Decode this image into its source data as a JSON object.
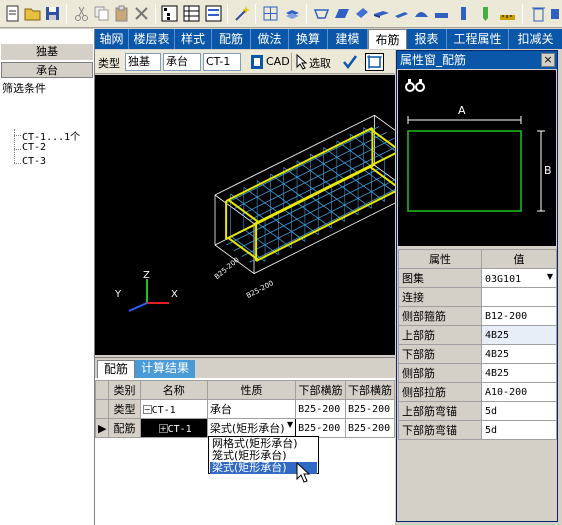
{
  "left_panel": {
    "header_1": "独基",
    "header_2": "承台",
    "filter_label": "筛选条件",
    "tree": [
      "CT-1...1个",
      "CT-2",
      "CT-3"
    ]
  },
  "module_tabs": [
    "轴网",
    "楼层表",
    "样式",
    "配筋",
    "做法",
    "换算",
    "建模",
    "布筋",
    "报表",
    "工程属性",
    "扣减关"
  ],
  "active_tab": "布筋",
  "sub_toolbar": {
    "type_label": "类型",
    "type_value": "独基",
    "subtype_value": "承台",
    "component_value": "CT-1",
    "cad_label": "CAD",
    "select_label": "选取"
  },
  "viewport": {
    "axes": {
      "z": "Z",
      "y": "Y",
      "x": "X"
    },
    "dim_labels": [
      "B25-200",
      "B25-200"
    ]
  },
  "bottom_panel": {
    "tabs": [
      "配筋",
      "计算结果"
    ],
    "columns": [
      "类别",
      "名称",
      "性质",
      "下部横筋",
      "下部横筋"
    ],
    "rows": [
      {
        "category": "类型",
        "name": "CT-1",
        "property": "承台",
        "bar_1": "B25-200",
        "bar_2": "B25-200"
      },
      {
        "category": "配筋",
        "name": "CT-1",
        "property": "梁式(矩形承台)",
        "bar_1": "B25-200",
        "bar_2": "B25-200"
      }
    ],
    "dropdown_options": [
      "网格式(矩形承台)",
      "笼式(矩形承台)",
      "梁式(矩形承台)"
    ],
    "dropdown_selected_index": 2
  },
  "property_window": {
    "title": "属性窗_配筋",
    "diagram_labels": {
      "a": "A",
      "b": "B"
    },
    "columns": [
      "属性",
      "值"
    ],
    "rows": [
      {
        "name": "图集",
        "value": "03G101"
      },
      {
        "name": "连接",
        "value": ""
      },
      {
        "name": "侧部箍筋",
        "value": "B12-200"
      },
      {
        "name": "上部筋",
        "value": "4B25"
      },
      {
        "name": "下部筋",
        "value": "4B25"
      },
      {
        "name": "侧部筋",
        "value": "4B25"
      },
      {
        "name": "侧部拉筋",
        "value": "A10-200"
      },
      {
        "name": "上部筋弯锚",
        "value": "5d"
      },
      {
        "name": "下部筋弯锚",
        "value": "5d"
      }
    ]
  },
  "colors": {
    "accent": "#0a56a8",
    "rebar_yellow": "#e8e800",
    "rebar_blue": "#3aa0e0",
    "diagram_green": "#20c020"
  }
}
